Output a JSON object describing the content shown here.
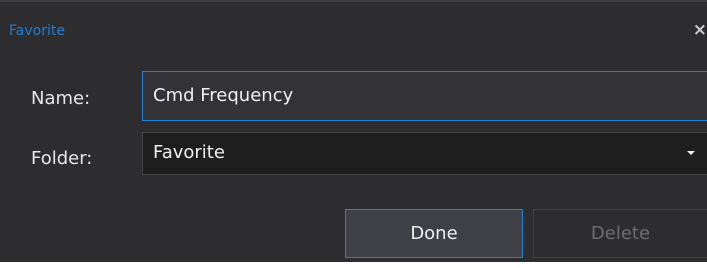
{
  "dialog": {
    "title": "Favorite",
    "close_glyph": "×",
    "name_label": "Name:",
    "name_value": "Cmd Frequency",
    "folder_label": "Folder:",
    "folder_selected": "Favorite",
    "done_label": "Done",
    "delete_label": "Delete",
    "colors": {
      "background": "#2d2d30",
      "accent": "#1c84d8",
      "title": "#1e7fd2",
      "disabled_text": "#6d6d6d"
    }
  }
}
